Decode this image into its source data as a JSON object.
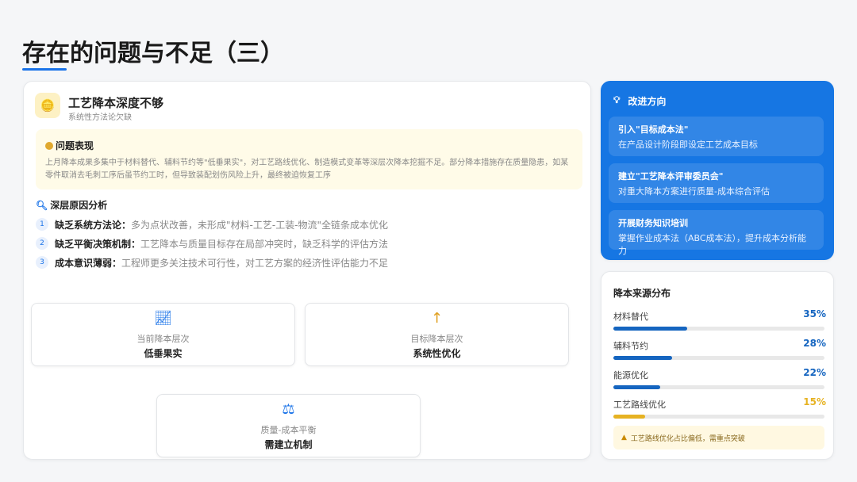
{
  "page": {
    "title": "存在的问题与不足（三）"
  },
  "left": {
    "title": "工艺降本深度不够",
    "subtitle": "系统性方法论欠缺",
    "issue": {
      "title": "问题表现",
      "body": "上月降本成果多集中于材料替代、辅料节约等\"低垂果实\"，对工艺路线优化、制造模式变革等深层次降本挖掘不足。部分降本措施存在质量隐患，如某零件取消去毛刺工序后虽节约工时，但导致装配划伤风险上升，最终被迫恢复工序"
    },
    "analysis": {
      "title": "深层原因分析",
      "items": [
        {
          "num": "1",
          "label": "缺乏系统方法论：",
          "text": "多为点状改善，未形成\"材料-工艺-工装-物流\"全链条成本优化"
        },
        {
          "num": "2",
          "label": "缺乏平衡决策机制：",
          "text": "工艺降本与质量目标存在局部冲突时，缺乏科学的评估方法"
        },
        {
          "num": "3",
          "label": "成本意识薄弱：",
          "text": "工程师更多关注技术可行性，对工艺方案的经济性评估能力不足"
        }
      ]
    },
    "stats": [
      {
        "icon": "chart-line-icon",
        "label": "当前降本层次",
        "value": "低垂果实"
      },
      {
        "icon": "arrow-up-icon",
        "label": "目标降本层次",
        "value": "系统性优化"
      },
      {
        "icon": "balance-scale-icon",
        "label": "质量-成本平衡",
        "value": "需建立机制"
      }
    ]
  },
  "improve": {
    "title": "改进方向",
    "items": [
      {
        "title": "引入\"目标成本法\"",
        "desc": "在产品设计阶段即设定工艺成本目标"
      },
      {
        "title": "建立\"工艺降本评审委员会\"",
        "desc": "对重大降本方案进行质量-成本综合评估"
      },
      {
        "title": "开展财务知识培训",
        "desc": "掌握作业成本法（ABC成本法），提升成本分析能力"
      }
    ]
  },
  "distribution": {
    "title": "降本来源分布",
    "items": [
      {
        "label": "材料替代",
        "value": 35,
        "text": "35%",
        "color": "#1565c0"
      },
      {
        "label": "辅料节约",
        "value": 28,
        "text": "28%",
        "color": "#1565c0"
      },
      {
        "label": "能源优化",
        "value": 22,
        "text": "22%",
        "color": "#1565c0"
      },
      {
        "label": "工艺路线优化",
        "value": 15,
        "text": "15%",
        "color": "#e6b222"
      }
    ],
    "warning": "工艺路线优化占比偏低，需重点突破"
  },
  "colors": {
    "accent": "#1676e3",
    "warning": "#e6b222"
  }
}
